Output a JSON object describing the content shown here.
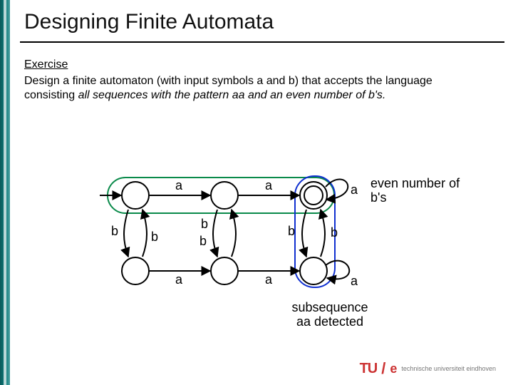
{
  "slide": {
    "title": "Designing Finite Automata",
    "exercise_label": "Exercise",
    "exercise_text_1": "Design a finite automaton (with input symbols a and b) that accepts the language consisting ",
    "exercise_text_ital": "all sequences with the pattern aa and an even number of b's.",
    "annot_even": "even number of b's",
    "annot_aa": "subsequence aa detected",
    "logo_tu": "TU",
    "logo_e": "e",
    "logo_txt": "technische universiteit eindhoven"
  },
  "chart_data": {
    "type": "diagram",
    "automaton": {
      "alphabet": [
        "a",
        "b"
      ],
      "states": [
        "q0",
        "q1",
        "q2",
        "q3",
        "q4",
        "q5"
      ],
      "layout": {
        "q0": {
          "row": 0,
          "col": 0
        },
        "q1": {
          "row": 0,
          "col": 1
        },
        "q2": {
          "row": 0,
          "col": 2,
          "accepting": true
        },
        "q3": {
          "row": 1,
          "col": 0
        },
        "q4": {
          "row": 1,
          "col": 1
        },
        "q5": {
          "row": 1,
          "col": 2
        }
      },
      "start": "q0",
      "accepting": [
        "q2"
      ],
      "transitions": [
        {
          "from": "q0",
          "to": "q1",
          "label": "a"
        },
        {
          "from": "q1",
          "to": "q2",
          "label": "a"
        },
        {
          "from": "q2",
          "to": "q2",
          "label": "a"
        },
        {
          "from": "q0",
          "to": "q3",
          "label": "b"
        },
        {
          "from": "q3",
          "to": "q0",
          "label": "b"
        },
        {
          "from": "q1",
          "to": "q4",
          "label": "b"
        },
        {
          "from": "q4",
          "to": "q1",
          "label": "b"
        },
        {
          "from": "q2",
          "to": "q5",
          "label": "b"
        },
        {
          "from": "q5",
          "to": "q2",
          "label": "b"
        },
        {
          "from": "q3",
          "to": "q4",
          "label": "a"
        },
        {
          "from": "q4",
          "to": "q5",
          "label": "a"
        },
        {
          "from": "q5",
          "to": "q5",
          "label": "a"
        }
      ],
      "groups": [
        {
          "name": "even-b",
          "states": [
            "q0",
            "q1",
            "q2"
          ],
          "annotation": "even number of b's"
        },
        {
          "name": "aa-detected",
          "states": [
            "q2",
            "q5"
          ],
          "annotation": "subsequence aa detected"
        }
      ]
    }
  }
}
